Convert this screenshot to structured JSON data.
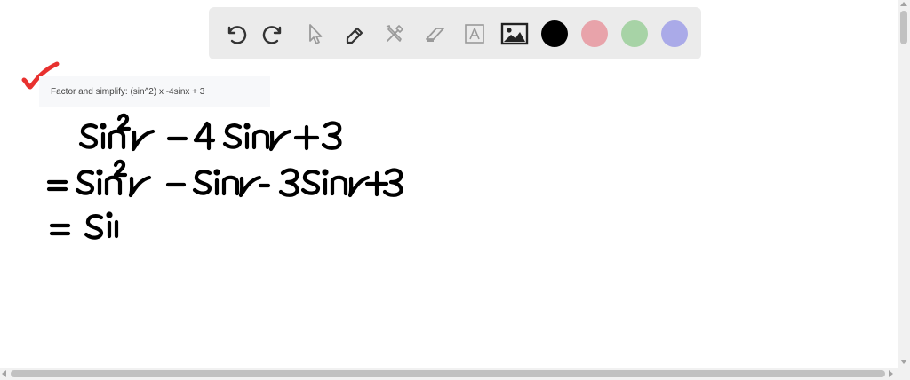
{
  "toolbar": {
    "tools": [
      {
        "icon": "undo-icon",
        "enabled": true
      },
      {
        "icon": "redo-icon",
        "enabled": true
      },
      {
        "icon": "select-pointer-icon",
        "enabled": false
      },
      {
        "icon": "pen-icon",
        "enabled": true
      },
      {
        "icon": "tools-icon",
        "enabled": false
      },
      {
        "icon": "eraser-icon",
        "enabled": false
      },
      {
        "icon": "text-box-icon",
        "enabled": false
      },
      {
        "icon": "image-icon",
        "enabled": true
      }
    ],
    "colors": [
      "#000000",
      "#e8a3aa",
      "#a7d3a6",
      "#aaaae8"
    ],
    "icon_color": "#333333",
    "disabled_icon_color": "#9a9a9a"
  },
  "question": {
    "text": "Factor and simplify: (sin^2) x -4sinx + 3"
  },
  "checkmark_color": "#e8312f",
  "handwriting": {
    "line1": "sin²x − 4 sinx + 3",
    "line2": "= sin²x − sinx − 3sinx + 3",
    "line3": "= si"
  }
}
